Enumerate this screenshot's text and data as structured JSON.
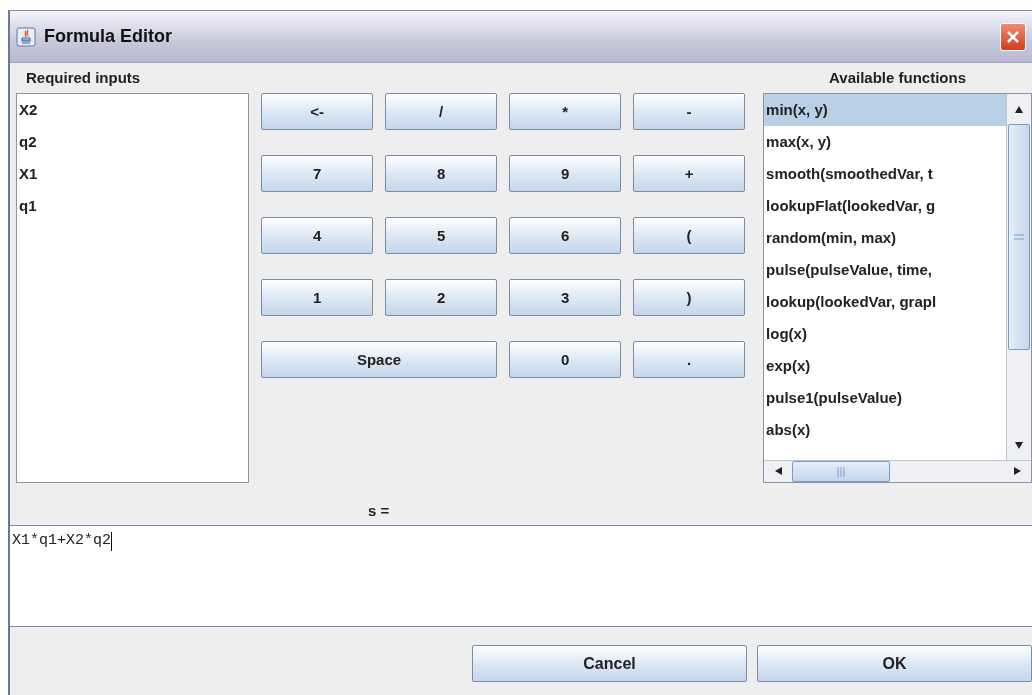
{
  "window": {
    "title": "Formula Editor"
  },
  "required_inputs": {
    "label": "Required inputs",
    "items": [
      {
        "label": "X2"
      },
      {
        "label": "q2"
      },
      {
        "label": "X1"
      },
      {
        "label": "q1"
      }
    ]
  },
  "keypad": [
    {
      "label": "<-",
      "kind": "key"
    },
    {
      "label": "/",
      "kind": "key"
    },
    {
      "label": "*",
      "kind": "key"
    },
    {
      "label": "-",
      "kind": "key"
    },
    {
      "label": "7",
      "kind": "key"
    },
    {
      "label": "8",
      "kind": "key"
    },
    {
      "label": "9",
      "kind": "key"
    },
    {
      "label": "+",
      "kind": "key"
    },
    {
      "label": "4",
      "kind": "key"
    },
    {
      "label": "5",
      "kind": "key"
    },
    {
      "label": "6",
      "kind": "key"
    },
    {
      "label": "(",
      "kind": "key"
    },
    {
      "label": "1",
      "kind": "key"
    },
    {
      "label": "2",
      "kind": "key"
    },
    {
      "label": "3",
      "kind": "key"
    },
    {
      "label": ")",
      "kind": "key"
    },
    {
      "label": "Space",
      "kind": "wide"
    },
    {
      "label": "0",
      "kind": "key"
    },
    {
      "label": ".",
      "kind": "key"
    }
  ],
  "available_functions": {
    "label": "Available functions",
    "items": [
      {
        "label": "min(x, y)",
        "selected": true
      },
      {
        "label": "max(x, y)",
        "selected": false
      },
      {
        "label": "smooth(smoothedVar, t",
        "selected": false
      },
      {
        "label": "lookupFlat(lookedVar, g",
        "selected": false
      },
      {
        "label": "random(min, max)",
        "selected": false
      },
      {
        "label": "pulse(pulseValue, time,",
        "selected": false
      },
      {
        "label": "lookup(lookedVar, grapl",
        "selected": false
      },
      {
        "label": "log(x)",
        "selected": false
      },
      {
        "label": "exp(x)",
        "selected": false
      },
      {
        "label": "pulse1(pulseValue)",
        "selected": false
      },
      {
        "label": "abs(x)",
        "selected": false
      }
    ]
  },
  "formula": {
    "label": "s =",
    "value": "X1*q1+X2*q2"
  },
  "buttons": [
    {
      "label": "Cancel"
    },
    {
      "label": "OK"
    }
  ]
}
